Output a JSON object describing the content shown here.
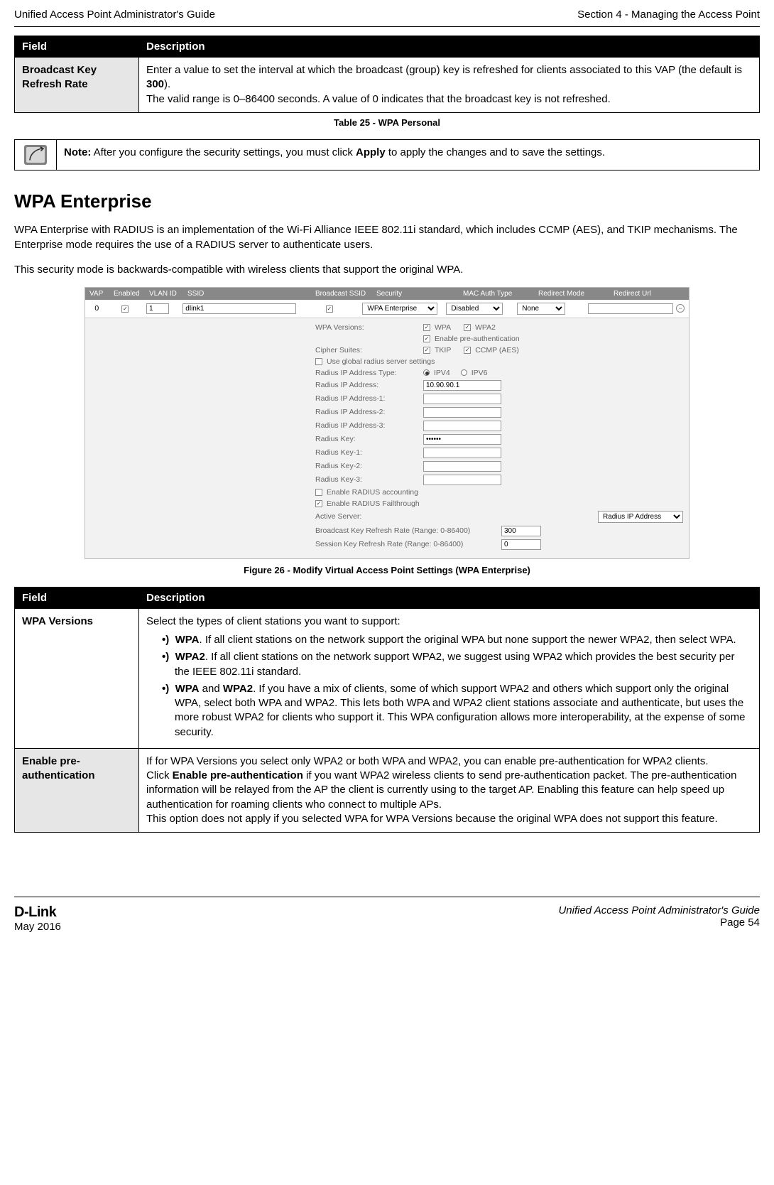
{
  "header": {
    "left": "Unified Access Point Administrator's Guide",
    "right": "Section 4 - Managing the Access Point"
  },
  "table25": {
    "col1": "Field",
    "col2": "Description",
    "row_field": "Broadcast Key Refresh Rate",
    "row_desc_p1": "Enter a value to set the interval at which the broadcast (group) key is refreshed for clients associated to this VAP (the default is ",
    "row_desc_bold1": "300",
    "row_desc_p2": ").",
    "row_desc_p3": "The valid range is 0–86400 seconds. A value of 0 indicates that the broadcast key is not refreshed.",
    "caption": "Table 25 - WPA Personal"
  },
  "note": {
    "bold": "Note:",
    "t1": " After you configure the security settings, you must click ",
    "bold2": "Apply",
    "t2": " to apply the changes and to save the settings."
  },
  "section": {
    "title": "WPA Enterprise",
    "p1": "WPA Enterprise with RADIUS is an implementation of the Wi-Fi Alliance IEEE 802.11i standard, which includes CCMP (AES), and TKIP mechanisms. The Enterprise mode requires the use of a RADIUS server to authenticate users.",
    "p2": "This security mode is backwards-compatible with wireless clients that support the original WPA."
  },
  "figure": {
    "header": {
      "vap": "VAP",
      "enabled": "Enabled",
      "vlan": "VLAN ID",
      "ssid": "SSID",
      "bcast": "Broadcast SSID",
      "sec": "Security",
      "mac": "MAC Auth Type",
      "redmode": "Redirect Mode",
      "redurl": "Redirect Url"
    },
    "row": {
      "vap": "0",
      "vlan": "1",
      "ssid": "dlink1",
      "security": "WPA Enterprise",
      "mac": "Disabled",
      "redmode": "None",
      "redurl": ""
    },
    "labels": {
      "wpa_versions": "WPA Versions:",
      "wpa": "WPA",
      "wpa2": "WPA2",
      "enable_pre": "Enable pre-authentication",
      "cipher": "Cipher Suites:",
      "tkip": "TKIP",
      "ccmp": "CCMP (AES)",
      "use_global": "Use global radius server settings",
      "ip_type": "Radius IP Address Type:",
      "ipv4": "IPV4",
      "ipv6": "IPV6",
      "ip": "Radius IP Address:",
      "ip1": "Radius IP Address-1:",
      "ip2": "Radius IP Address-2:",
      "ip3": "Radius IP Address-3:",
      "key": "Radius Key:",
      "key1": "Radius Key-1:",
      "key2": "Radius Key-2:",
      "key3": "Radius Key-3:",
      "acct": "Enable RADIUS accounting",
      "fail": "Enable RADIUS Failthrough",
      "active": "Active Server:",
      "active_val": "Radius IP Address",
      "brate": "Broadcast Key Refresh Rate (Range: 0-86400)",
      "srate": "Session Key Refresh Rate (Range: 0-86400)"
    },
    "values": {
      "ip": "10.90.90.1",
      "key": "••••••",
      "brate": "300",
      "srate": "0"
    },
    "caption": "Figure 26 - Modify Virtual Access Point Settings (WPA Enterprise)"
  },
  "table26": {
    "col1": "Field",
    "col2": "Description",
    "r1_field": "WPA Versions",
    "r1_intro": "Select the types of client stations you want to support:",
    "r1_b1_bold": "WPA",
    "r1_b1_text": ". If all client stations on the network support the original WPA but none support the newer WPA2, then select WPA.",
    "r1_b2_bold": "WPA2",
    "r1_b2_text": ". If all client stations on the network support WPA2, we suggest using WPA2 which provides the best security per the IEEE 802.11i standard.",
    "r1_b3_bold1": "WPA",
    "r1_b3_mid": " and ",
    "r1_b3_bold2": "WPA2",
    "r1_b3_text": ". If you have a mix of clients, some of which support WPA2 and others which support only the original WPA, select both WPA and WPA2. This lets both WPA and WPA2 client stations associate and authenticate, but uses the more robust WPA2 for clients who support it. This WPA configuration allows more interoperability, at the expense of some security.",
    "r2_field": "Enable pre-authentication",
    "r2_p1": "If for WPA Versions you select only WPA2 or both WPA and WPA2, you can enable pre-authentication for WPA2 clients.",
    "r2_p2a": "Click ",
    "r2_p2bold": "Enable pre-authentication",
    "r2_p2b": " if you want WPA2 wireless clients to send pre-authentication packet. The pre-authentication information will be relayed from the AP the client is currently using to the target AP. Enabling this feature can help speed up authentication for roaming clients who connect to multiple APs.",
    "r2_p3": "This option does not apply if you selected WPA for WPA Versions because the original WPA does not support this feature."
  },
  "footer": {
    "brand": "D-Link",
    "date": "May 2016",
    "title": "Unified Access Point Administrator's Guide",
    "page": "Page 54"
  }
}
